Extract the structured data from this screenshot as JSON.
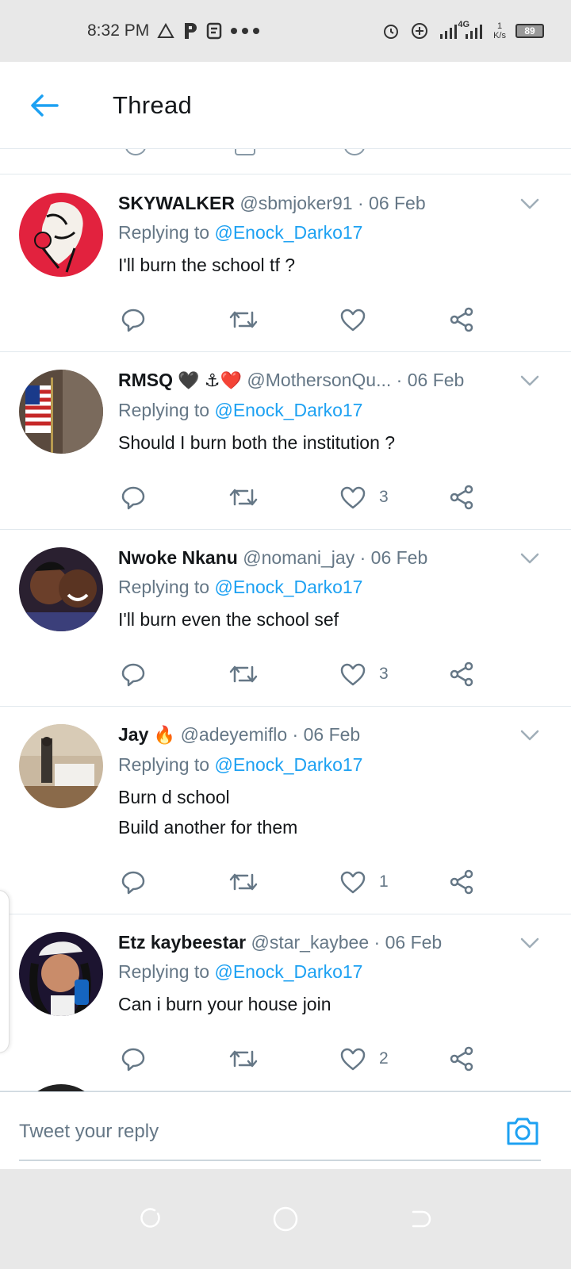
{
  "status_bar": {
    "time": "8:32 PM",
    "network": "4G",
    "speed_unit": "K/s",
    "speed_value": "1",
    "battery": "89",
    "icons": [
      "warning-icon",
      "p-app-icon",
      "app-icon",
      "more-dots-icon",
      "alarm-icon",
      "data-saver-icon",
      "signal-icon",
      "battery-icon"
    ]
  },
  "header": {
    "title": "Thread",
    "back_icon": "back-arrow-icon"
  },
  "colors": {
    "accent": "#1da1f2",
    "secondary_text": "#657786",
    "divider": "#e1e8ed",
    "system_bar": "#e8e8e8"
  },
  "replying_label": "Replying to",
  "tweets": [
    {
      "name": "SKYWALKER",
      "name_emoji": "",
      "handle": "@sbmjoker91",
      "date": "06 Feb",
      "replying_to": "@Enock_Darko17",
      "text": [
        "I'll burn the school tf ?"
      ],
      "likes": "",
      "avatar_desc": "joker-art"
    },
    {
      "name": "RMSQ",
      "name_emoji": "🖤 ⚓❤️",
      "handle": "@MothersonQu...",
      "date": "06 Feb",
      "replying_to": "@Enock_Darko17",
      "text": [
        "Should I burn both the institution ?"
      ],
      "likes": "3",
      "avatar_desc": "flag"
    },
    {
      "name": "Nwoke Nkanu",
      "name_emoji": "",
      "handle": "@nomani_jay",
      "date": "06 Feb",
      "replying_to": "@Enock_Darko17",
      "text": [
        "I'll burn even the school sef"
      ],
      "likes": "3",
      "avatar_desc": "two-people"
    },
    {
      "name": "Jay",
      "name_emoji": "🔥",
      "handle": "@adeyemiflo",
      "date": "06 Feb",
      "replying_to": "@Enock_Darko17",
      "text": [
        "Burn d school",
        "Build another for them"
      ],
      "likes": "1",
      "avatar_desc": "room-mirror"
    },
    {
      "name": "Etz kaybeestar",
      "name_emoji": "",
      "handle": "@star_kaybee",
      "date": "06 Feb",
      "replying_to": "@Enock_Darko17",
      "text": [
        "Can i burn your house join"
      ],
      "likes": "2",
      "avatar_desc": "selfie-can"
    }
  ],
  "reply_bar": {
    "placeholder": "Tweet your reply",
    "camera_icon": "camera-icon"
  },
  "nav_bar": {
    "icons": [
      "recents-icon",
      "home-icon",
      "back-icon"
    ]
  }
}
